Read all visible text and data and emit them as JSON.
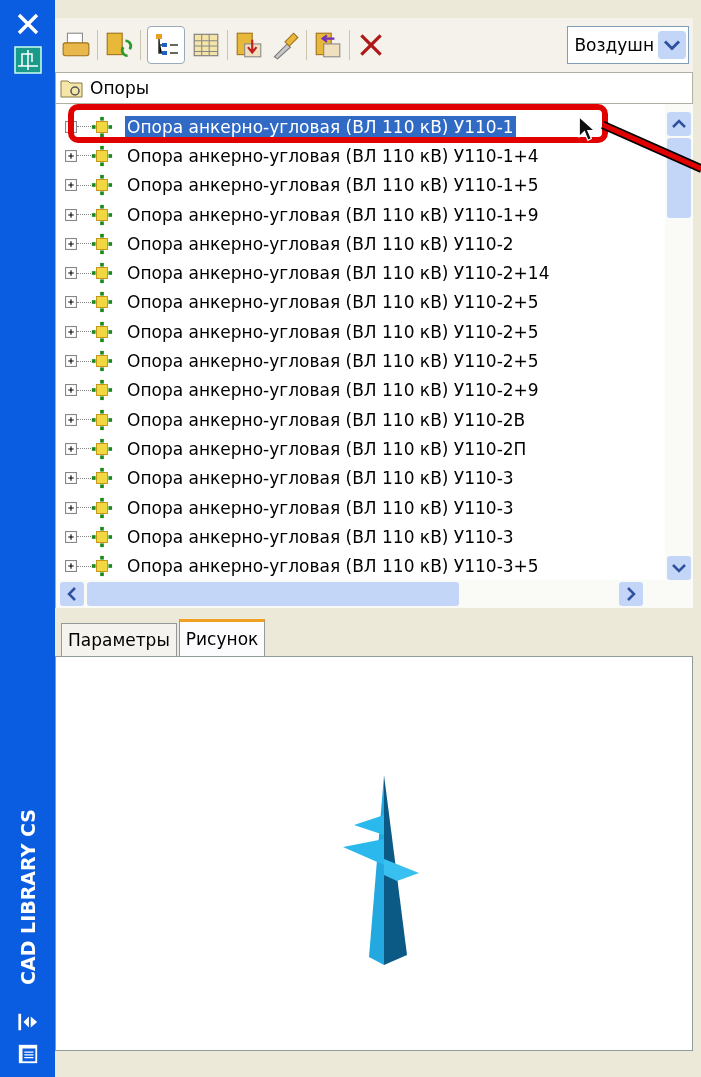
{
  "sidebar": {
    "title": "CAD LIBRARY CS"
  },
  "toolbar": {
    "dropdown": {
      "value": "Воздушн"
    }
  },
  "folder": {
    "label": "Опоры"
  },
  "tree": {
    "items": [
      {
        "label": "Опора анкерно-угловая (ВЛ 110 кВ) У110-1",
        "selected": true,
        "expanded": false
      },
      {
        "label": "Опора анкерно-угловая (ВЛ 110 кВ) У110-1+4",
        "selected": false,
        "expanded": false
      },
      {
        "label": "Опора анкерно-угловая (ВЛ 110 кВ) У110-1+5",
        "selected": false,
        "expanded": false
      },
      {
        "label": "Опора анкерно-угловая (ВЛ 110 кВ) У110-1+9",
        "selected": false,
        "expanded": false
      },
      {
        "label": "Опора анкерно-угловая (ВЛ 110 кВ) У110-2",
        "selected": false,
        "expanded": false
      },
      {
        "label": "Опора анкерно-угловая (ВЛ 110 кВ) У110-2+14",
        "selected": false,
        "expanded": false
      },
      {
        "label": "Опора анкерно-угловая (ВЛ 110 кВ) У110-2+5",
        "selected": false,
        "expanded": false
      },
      {
        "label": "Опора анкерно-угловая (ВЛ 110 кВ) У110-2+5",
        "selected": false,
        "expanded": false
      },
      {
        "label": "Опора анкерно-угловая (ВЛ 110 кВ) У110-2+5",
        "selected": false,
        "expanded": false
      },
      {
        "label": "Опора анкерно-угловая (ВЛ 110 кВ) У110-2+9",
        "selected": false,
        "expanded": false
      },
      {
        "label": "Опора анкерно-угловая (ВЛ 110 кВ) У110-2В",
        "selected": false,
        "expanded": false
      },
      {
        "label": "Опора анкерно-угловая (ВЛ 110 кВ) У110-2П",
        "selected": false,
        "expanded": false
      },
      {
        "label": "Опора анкерно-угловая (ВЛ 110 кВ) У110-3",
        "selected": false,
        "expanded": false
      },
      {
        "label": "Опора анкерно-угловая (ВЛ 110 кВ) У110-3",
        "selected": false,
        "expanded": false
      },
      {
        "label": "Опора анкерно-угловая (ВЛ 110 кВ) У110-3",
        "selected": false,
        "expanded": false
      },
      {
        "label": "Опора анкерно-угловая (ВЛ 110 кВ) У110-3+5",
        "selected": false,
        "expanded": false
      }
    ]
  },
  "tabs": [
    {
      "label": "Параметры",
      "selected": false
    },
    {
      "label": "Рисунок",
      "selected": true
    }
  ]
}
